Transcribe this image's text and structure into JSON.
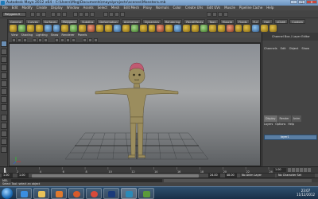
{
  "window": {
    "title": "Autodesk Maya 2012 x64",
    "path": " - C:\\Users\\Meg\\Documents\\maya\\projects\\scenes\\Monstera.mb"
  },
  "menubar": [
    "File",
    "Edit",
    "Modify",
    "Create",
    "Display",
    "Window",
    "Assets",
    "Select",
    "Mesh",
    "Edit Mesh",
    "Proxy",
    "Normals",
    "Color",
    "Create UVs",
    "Edit UVs",
    "Muscle",
    "Pipeline Cache",
    "Help"
  ],
  "status": {
    "mode": "Polygons"
  },
  "shelf": {
    "tabs": [
      "General",
      "Curves",
      "Surfaces",
      "Polygons",
      "Subdivs",
      "Deformation",
      "Animation",
      "Dynamics",
      "Rendering",
      "PaintEffects",
      "Toon",
      "Muscle",
      "Fluids",
      "Fur",
      "Hair",
      "nCloth",
      "Custom"
    ],
    "active": "Polygons"
  },
  "panel": {
    "menu": [
      "View",
      "Shading",
      "Lighting",
      "Show",
      "Renderer",
      "Panels"
    ]
  },
  "channel_box": {
    "title": "Channel Box / Layer Editor",
    "menu": [
      "Channels",
      "Edit",
      "Object",
      "Show"
    ],
    "layer_tabs": [
      "Display",
      "Render",
      "Anim"
    ],
    "layer_menu": [
      "Layers",
      "Options",
      "Help"
    ],
    "layer_name": "layer1"
  },
  "timeline": {
    "ticks": [
      "1",
      "2",
      "4",
      "6",
      "8",
      "10",
      "12",
      "14",
      "16",
      "18",
      "20",
      "22",
      "24"
    ],
    "current_frame": "1.00"
  },
  "range": {
    "start": "1.00",
    "inner_start": "1.00",
    "inner_end": "24.00",
    "end": "48.00",
    "anim_layer": "No Anim Layer",
    "char_set": "No Character Set"
  },
  "cmdline": {
    "label": "MEL"
  },
  "help_line": "Select Tool: select an object",
  "taskbar": {
    "time": "23:07",
    "date": "11/12/2012"
  }
}
